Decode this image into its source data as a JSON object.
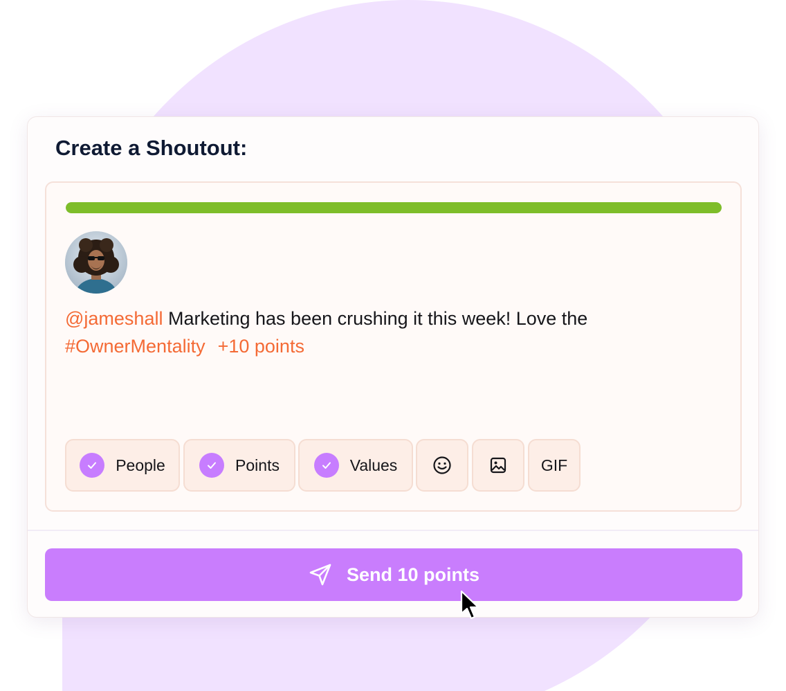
{
  "shoutout": {
    "title": "Create a Shoutout:",
    "progress": 1.0,
    "message": {
      "mention": "@jameshall",
      "text": " Marketing has been crushing it this week! Love the",
      "hashtag": "#OwnerMentality",
      "points_tag": "+10 points"
    },
    "chips": [
      {
        "label": "People",
        "checked": true
      },
      {
        "label": "Points",
        "checked": true
      },
      {
        "label": "Values",
        "checked": true
      }
    ],
    "gif_label": "GIF",
    "send_label": "Send 10 points"
  },
  "colors": {
    "accent": "#c97dfd",
    "progress": "#7ebd2a",
    "tag": "#f46a35",
    "title": "#0f1a33",
    "blob": "#f1e2ff"
  },
  "icons": [
    "check-icon",
    "smiley-icon",
    "image-icon",
    "send-icon",
    "mouse-cursor-icon"
  ]
}
